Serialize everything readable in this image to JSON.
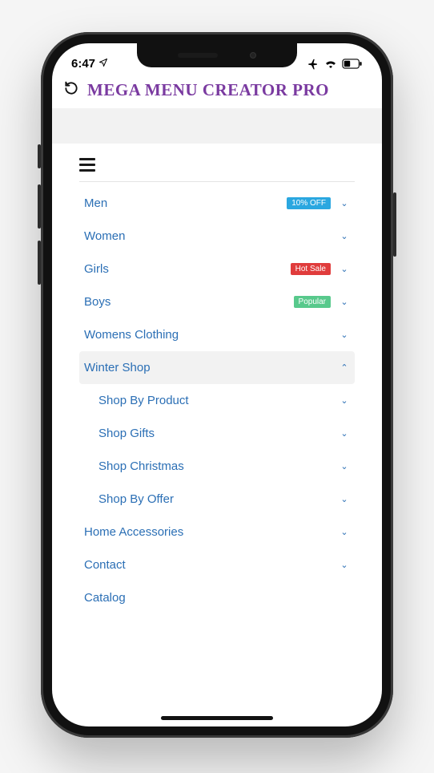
{
  "status": {
    "time": "6:47"
  },
  "header": {
    "title": "MEGA MENU CREATOR PRO"
  },
  "menu": {
    "main": [
      {
        "label": "Men",
        "badge": "10% OFF",
        "badgeColor": "blue",
        "expanded": false
      },
      {
        "label": "Women",
        "badge": null,
        "expanded": false
      },
      {
        "label": "Girls",
        "badge": "Hot Sale",
        "badgeColor": "red",
        "expanded": false
      },
      {
        "label": "Boys",
        "badge": "Popular",
        "badgeColor": "green",
        "expanded": false
      },
      {
        "label": "Womens Clothing",
        "badge": null,
        "expanded": false
      },
      {
        "label": "Winter Shop",
        "badge": null,
        "expanded": true
      }
    ],
    "winterSub": [
      {
        "label": "Shop By Product"
      },
      {
        "label": "Shop Gifts"
      },
      {
        "label": "Shop Christmas"
      },
      {
        "label": "Shop By Offer"
      }
    ],
    "tail": [
      {
        "label": "Home Accessories",
        "hasChildren": true
      },
      {
        "label": "Contact",
        "hasChildren": true
      },
      {
        "label": "Catalog",
        "hasChildren": false
      }
    ]
  }
}
